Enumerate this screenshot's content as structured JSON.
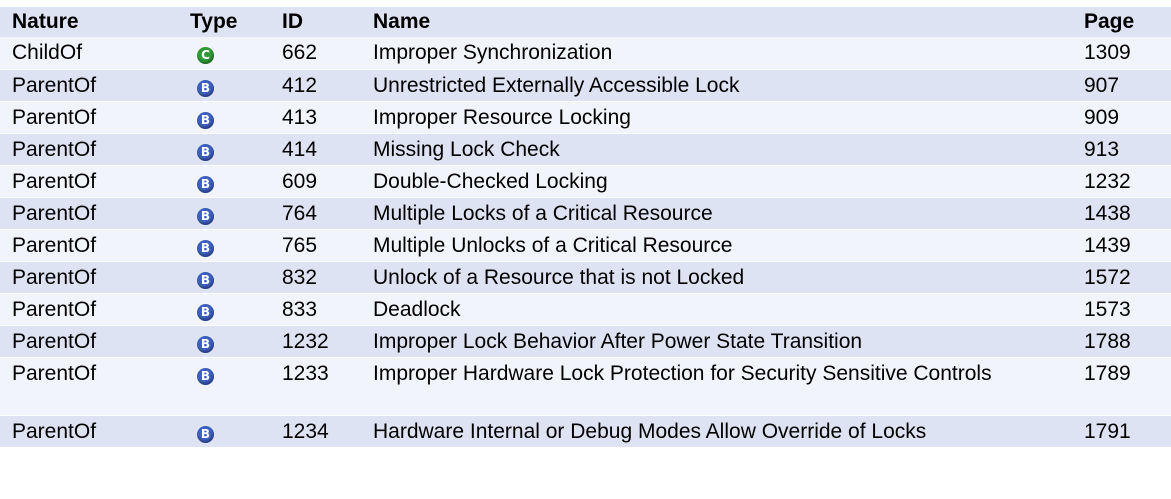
{
  "headers": {
    "nature": "Nature",
    "type": "Type",
    "id": "ID",
    "name": "Name",
    "page": "Page"
  },
  "colors": {
    "header_bg": "#dee3f3",
    "row_alt_bg": "#dee3f3",
    "row_bg": "#f2f4fb",
    "class_icon": "#2f9a35",
    "base_icon": "#3f5fc0"
  },
  "rows": [
    {
      "nature": "ChildOf",
      "type_icon": "class-c-icon",
      "type_letter": "C",
      "id": "662",
      "name": "Improper Synchronization",
      "page": "1309"
    },
    {
      "nature": "ParentOf",
      "type_icon": "base-b-icon",
      "type_letter": "B",
      "id": "412",
      "name": "Unrestricted Externally Accessible Lock",
      "page": "907"
    },
    {
      "nature": "ParentOf",
      "type_icon": "base-b-icon",
      "type_letter": "B",
      "id": "413",
      "name": "Improper Resource Locking",
      "page": "909"
    },
    {
      "nature": "ParentOf",
      "type_icon": "base-b-icon",
      "type_letter": "B",
      "id": "414",
      "name": "Missing Lock Check",
      "page": "913"
    },
    {
      "nature": "ParentOf",
      "type_icon": "base-b-icon",
      "type_letter": "B",
      "id": "609",
      "name": "Double-Checked Locking",
      "page": "1232"
    },
    {
      "nature": "ParentOf",
      "type_icon": "base-b-icon",
      "type_letter": "B",
      "id": "764",
      "name": "Multiple Locks of a Critical Resource",
      "page": "1438"
    },
    {
      "nature": "ParentOf",
      "type_icon": "base-b-icon",
      "type_letter": "B",
      "id": "765",
      "name": "Multiple Unlocks of a Critical Resource",
      "page": "1439"
    },
    {
      "nature": "ParentOf",
      "type_icon": "base-b-icon",
      "type_letter": "B",
      "id": "832",
      "name": "Unlock of a Resource that is not Locked",
      "page": "1572"
    },
    {
      "nature": "ParentOf",
      "type_icon": "base-b-icon",
      "type_letter": "B",
      "id": "833",
      "name": "Deadlock",
      "page": "1573"
    },
    {
      "nature": "ParentOf",
      "type_icon": "base-b-icon",
      "type_letter": "B",
      "id": "1232",
      "name": "Improper Lock Behavior After Power State Transition",
      "page": "1788"
    },
    {
      "nature": "ParentOf",
      "type_icon": "base-b-icon",
      "type_letter": "B",
      "id": "1233",
      "name": "Improper Hardware Lock Protection for Security Sensitive Controls",
      "page": "1789"
    },
    {
      "nature": "ParentOf",
      "type_icon": "base-b-icon",
      "type_letter": "B",
      "id": "1234",
      "name": "Hardware Internal or Debug Modes Allow Override of Locks",
      "page": "1791"
    }
  ]
}
